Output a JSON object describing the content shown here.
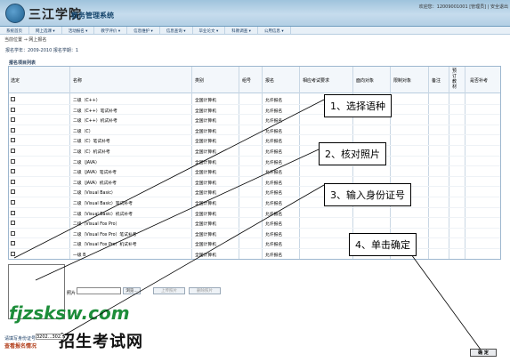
{
  "header": {
    "school": "三江学院",
    "system": "教务管理系统",
    "welcome": "欢迎您：12009001001 [管理员]  | 安全退出"
  },
  "nav": [
    {
      "label": "系统首页"
    },
    {
      "label": "网上选课 ▾"
    },
    {
      "label": "活动报名 ▾"
    },
    {
      "label": "教学评价 ▾"
    },
    {
      "label": "信息维护 ▾"
    },
    {
      "label": "信息查询 ▾"
    },
    {
      "label": "毕业论文 ▾"
    },
    {
      "label": "科教调查 ▾"
    },
    {
      "label": "公用信息 ▾"
    }
  ],
  "breadcrumb": "当前位置 → 网上报名",
  "subheader": "报名学年：2009-2010    报名学期：1",
  "table": {
    "title": "报名项目列表",
    "headers": {
      "select": "选定",
      "name": "名称",
      "category": "类别",
      "group": "组号",
      "signup": "报名",
      "req": "相应考试要求",
      "target": "面向对象",
      "limit": "限制对象",
      "note": "备注",
      "booked": "预订教材",
      "resit": "是否补考"
    },
    "rows": [
      {
        "name": "二级（C++）",
        "category": "全国计算机",
        "signup": "允许报名"
      },
      {
        "name": "二级（C++）笔试补考",
        "category": "全国计算机",
        "signup": "允许报名"
      },
      {
        "name": "二级（C++）机试补考",
        "category": "全国计算机",
        "signup": "允许报名"
      },
      {
        "name": "二级（C）",
        "category": "全国计算机",
        "signup": "允许报名"
      },
      {
        "name": "二级（C）笔试补考",
        "category": "全国计算机",
        "signup": "允许报名"
      },
      {
        "name": "二级（C）机试补考",
        "category": "全国计算机",
        "signup": "允许报名"
      },
      {
        "name": "二级（JAVA）",
        "category": "全国计算机",
        "signup": "允许报名"
      },
      {
        "name": "二级（JAVA）笔试补考",
        "category": "全国计算机",
        "signup": "允许报名"
      },
      {
        "name": "二级（JAVA）机试补考",
        "category": "全国计算机",
        "signup": "允许报名"
      },
      {
        "name": "二级（Visual Basic）",
        "category": "全国计算机",
        "signup": "允许报名"
      },
      {
        "name": "二级（Visual Basic）笔试补考",
        "category": "全国计算机",
        "signup": "允许报名"
      },
      {
        "name": "二级（Visual Basic）机试补考",
        "category": "全国计算机",
        "signup": "允许报名"
      },
      {
        "name": "二级（Visual Fox Pro）",
        "category": "全国计算机",
        "signup": "允许报名"
      },
      {
        "name": "二级（Visual Fox Pro）笔试补考",
        "category": "全国计算机",
        "signup": "允许报名"
      },
      {
        "name": "二级（Visual Fox Pro）机试补考",
        "category": "全国计算机",
        "signup": "允许报名"
      },
      {
        "name": "一级 B",
        "category": "全国计算机",
        "signup": "允许报名"
      }
    ]
  },
  "photo": {
    "label": "照片",
    "browse": "浏览...",
    "upload": "上传照片",
    "delete": "删除照片"
  },
  "watermark": {
    "site": "fjzsksw.com",
    "brand": "招生考试网"
  },
  "id_field": {
    "label": "请填写身份证号：",
    "value": "3202...302..."
  },
  "check_link": "查看报名情况",
  "confirm_button": "确 定",
  "callouts": [
    {
      "text": "1、选择语种"
    },
    {
      "text": "2、核对照片"
    },
    {
      "text": "3、输入身份证号"
    },
    {
      "text": "4、单击确定"
    }
  ]
}
